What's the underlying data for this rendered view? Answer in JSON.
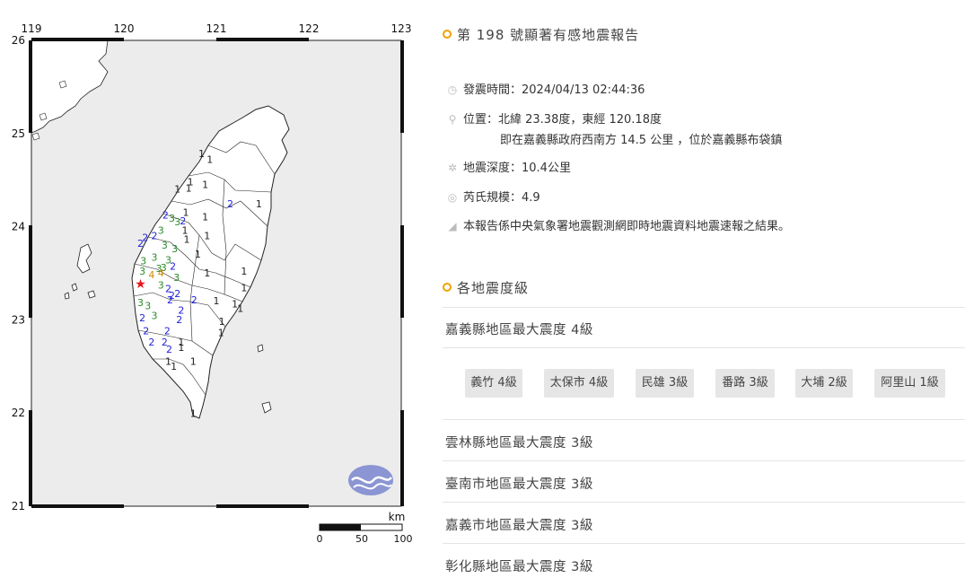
{
  "map": {
    "lon_ticks": [
      "119",
      "120",
      "121",
      "122",
      "123"
    ],
    "lat_ticks": [
      "26",
      "25",
      "24",
      "23",
      "22",
      "21"
    ],
    "scale_unit": "km",
    "scale_labels": [
      "0",
      "50",
      "100"
    ],
    "intensity_labels": [
      {
        "v": "1",
        "lon": 120.84,
        "lat": 24.78
      },
      {
        "v": "1",
        "lon": 120.93,
        "lat": 24.72
      },
      {
        "v": "1",
        "lon": 120.58,
        "lat": 24.4
      },
      {
        "v": "1",
        "lon": 120.72,
        "lat": 24.48
      },
      {
        "v": "1",
        "lon": 120.7,
        "lat": 24.41
      },
      {
        "v": "1",
        "lon": 120.88,
        "lat": 24.45
      },
      {
        "v": "1",
        "lon": 121.46,
        "lat": 24.24
      },
      {
        "v": "1",
        "lon": 120.67,
        "lat": 24.15
      },
      {
        "v": "1",
        "lon": 120.88,
        "lat": 24.1
      },
      {
        "v": "1",
        "lon": 120.66,
        "lat": 23.96
      },
      {
        "v": "1",
        "lon": 120.68,
        "lat": 23.86
      },
      {
        "v": "1",
        "lon": 120.9,
        "lat": 23.9
      },
      {
        "v": "1",
        "lon": 120.8,
        "lat": 23.7
      },
      {
        "v": "1",
        "lon": 120.9,
        "lat": 23.5
      },
      {
        "v": "1",
        "lon": 121.3,
        "lat": 23.52
      },
      {
        "v": "1",
        "lon": 121.3,
        "lat": 23.34
      },
      {
        "v": "1",
        "lon": 121.0,
        "lat": 23.2
      },
      {
        "v": "1",
        "lon": 121.2,
        "lat": 23.17
      },
      {
        "v": "1",
        "lon": 121.26,
        "lat": 23.12
      },
      {
        "v": "1",
        "lon": 121.06,
        "lat": 22.98
      },
      {
        "v": "1",
        "lon": 121.05,
        "lat": 22.86
      },
      {
        "v": "1",
        "lon": 120.62,
        "lat": 22.76
      },
      {
        "v": "1",
        "lon": 120.62,
        "lat": 22.7
      },
      {
        "v": "1",
        "lon": 120.48,
        "lat": 22.55
      },
      {
        "v": "1",
        "lon": 120.54,
        "lat": 22.5
      },
      {
        "v": "1",
        "lon": 120.75,
        "lat": 22.55
      },
      {
        "v": "1",
        "lon": 120.75,
        "lat": 21.99
      },
      {
        "v": "2",
        "lon": 121.15,
        "lat": 24.24
      },
      {
        "v": "2",
        "lon": 120.45,
        "lat": 24.12
      },
      {
        "v": "2",
        "lon": 120.64,
        "lat": 24.06
      },
      {
        "v": "2",
        "lon": 120.18,
        "lat": 23.82
      },
      {
        "v": "2",
        "lon": 120.23,
        "lat": 23.88
      },
      {
        "v": "2",
        "lon": 120.33,
        "lat": 23.9
      },
      {
        "v": "2",
        "lon": 120.53,
        "lat": 23.57
      },
      {
        "v": "2",
        "lon": 120.48,
        "lat": 23.33
      },
      {
        "v": "2",
        "lon": 120.52,
        "lat": 23.26
      },
      {
        "v": "2",
        "lon": 120.58,
        "lat": 23.28
      },
      {
        "v": "2",
        "lon": 120.5,
        "lat": 23.21
      },
      {
        "v": "2",
        "lon": 120.76,
        "lat": 23.21
      },
      {
        "v": "2",
        "lon": 120.62,
        "lat": 23.1
      },
      {
        "v": "2",
        "lon": 120.6,
        "lat": 23.0
      },
      {
        "v": "2",
        "lon": 120.2,
        "lat": 23.02
      },
      {
        "v": "2",
        "lon": 120.47,
        "lat": 22.88
      },
      {
        "v": "2",
        "lon": 120.24,
        "lat": 22.88
      },
      {
        "v": "2",
        "lon": 120.3,
        "lat": 22.76
      },
      {
        "v": "2",
        "lon": 120.44,
        "lat": 22.76
      },
      {
        "v": "2",
        "lon": 120.49,
        "lat": 22.68
      },
      {
        "v": "3",
        "lon": 120.52,
        "lat": 24.09
      },
      {
        "v": "3",
        "lon": 120.58,
        "lat": 24.05
      },
      {
        "v": "3",
        "lon": 120.4,
        "lat": 23.96
      },
      {
        "v": "3",
        "lon": 120.44,
        "lat": 23.8
      },
      {
        "v": "3",
        "lon": 120.33,
        "lat": 23.67
      },
      {
        "v": "3",
        "lon": 120.38,
        "lat": 23.55
      },
      {
        "v": "3",
        "lon": 120.48,
        "lat": 23.64
      },
      {
        "v": "3",
        "lon": 120.55,
        "lat": 23.76
      },
      {
        "v": "3",
        "lon": 120.21,
        "lat": 23.63
      },
      {
        "v": "3",
        "lon": 120.2,
        "lat": 23.52
      },
      {
        "v": "3",
        "lon": 120.43,
        "lat": 23.56
      },
      {
        "v": "3",
        "lon": 120.57,
        "lat": 23.45
      },
      {
        "v": "3",
        "lon": 120.4,
        "lat": 23.37
      },
      {
        "v": "3",
        "lon": 120.18,
        "lat": 23.18
      },
      {
        "v": "3",
        "lon": 120.26,
        "lat": 23.15
      },
      {
        "v": "3",
        "lon": 120.33,
        "lat": 23.04
      },
      {
        "v": "4",
        "lon": 120.3,
        "lat": 23.48
      },
      {
        "v": "4",
        "lon": 120.4,
        "lat": 23.5
      }
    ],
    "epicenter": {
      "lon": 120.18,
      "lat": 23.38
    },
    "colors": {
      "i1": "#222222",
      "i2": "#2222dd",
      "i3": "#2a8a2a",
      "i4": "#d08a00",
      "epicenter": "#e8141b",
      "land": "#ffffff",
      "sea": "#ececec"
    }
  },
  "report": {
    "title": "第 198 號顯著有感地震報告",
    "time": "發震時間：2024/04/13 02:44:36",
    "location": "位置：北緯 23.38度，東經 120.18度",
    "location_detail": "即在嘉義縣政府西南方 14.5 公里 ，位於嘉義縣布袋鎮",
    "depth": "地震深度：10.4公里",
    "magnitude": "芮氏規模：4.9",
    "note": "本報告係中央氣象署地震觀測網即時地震資料地震速報之結果。",
    "icons": [
      "clock-icon",
      "location-pin-icon",
      "depth-icon",
      "magnitude-icon",
      "megaphone-icon"
    ]
  },
  "intensity": {
    "title": "各地震度級",
    "county_1": "嘉義縣地區最大震度 4級",
    "stations": [
      "義竹 4級",
      "太保市 4級",
      "民雄 3級",
      "番路 3級",
      "大埔 2級",
      "阿里山 1級"
    ],
    "county_2": "雲林縣地區最大震度 3級",
    "county_3": "臺南市地區最大震度 3級",
    "county_4": "嘉義市地區最大震度 3級",
    "county_5": "彰化縣地區最大震度 3級"
  }
}
